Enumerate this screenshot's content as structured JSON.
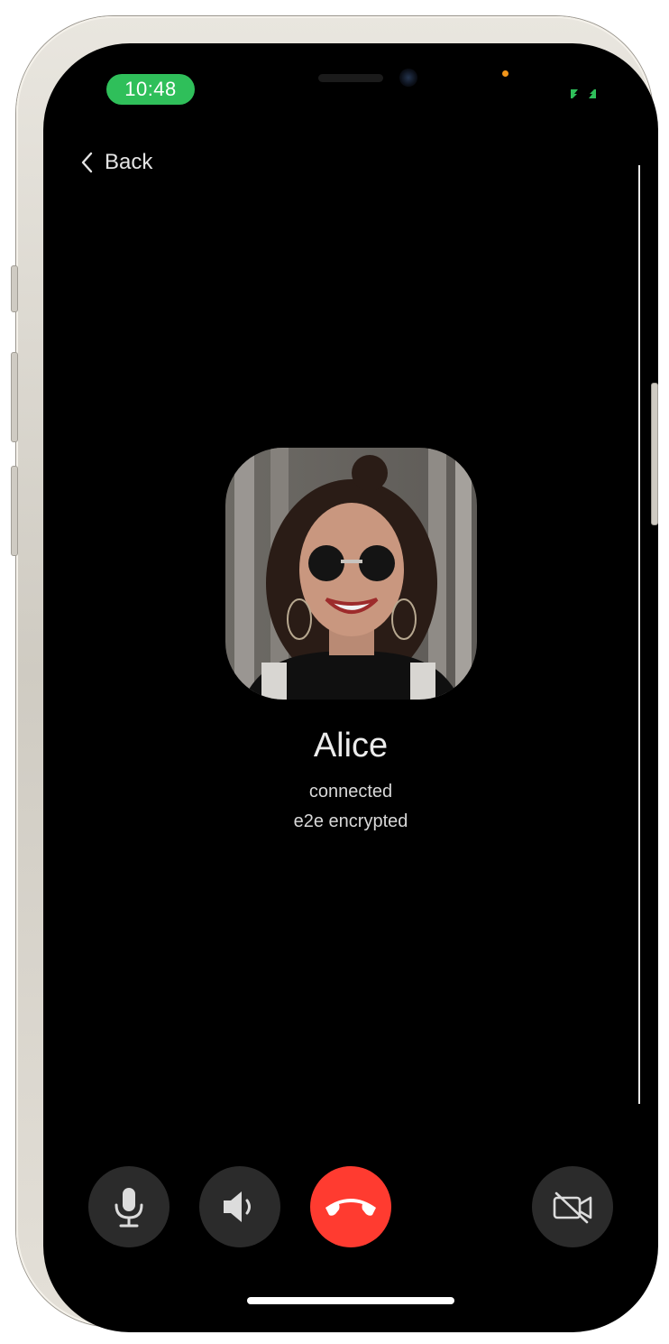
{
  "status_bar": {
    "time": "10:48",
    "indicator_icon": "call-status-icon"
  },
  "nav": {
    "back_label": "Back",
    "back_icon": "chevron-left-icon"
  },
  "caller": {
    "name": "Alice",
    "status": "connected",
    "encryption": "e2e encrypted",
    "avatar": "contact-photo"
  },
  "controls": {
    "mute": {
      "icon": "microphone-icon"
    },
    "speaker": {
      "icon": "speaker-icon"
    },
    "end_call": {
      "icon": "end-call-icon"
    },
    "video": {
      "icon": "video-off-icon"
    }
  },
  "colors": {
    "accent_green": "#2fbf5a",
    "end_call_red": "#ff3b30",
    "control_bg": "#2b2b2b",
    "background": "#000000"
  }
}
